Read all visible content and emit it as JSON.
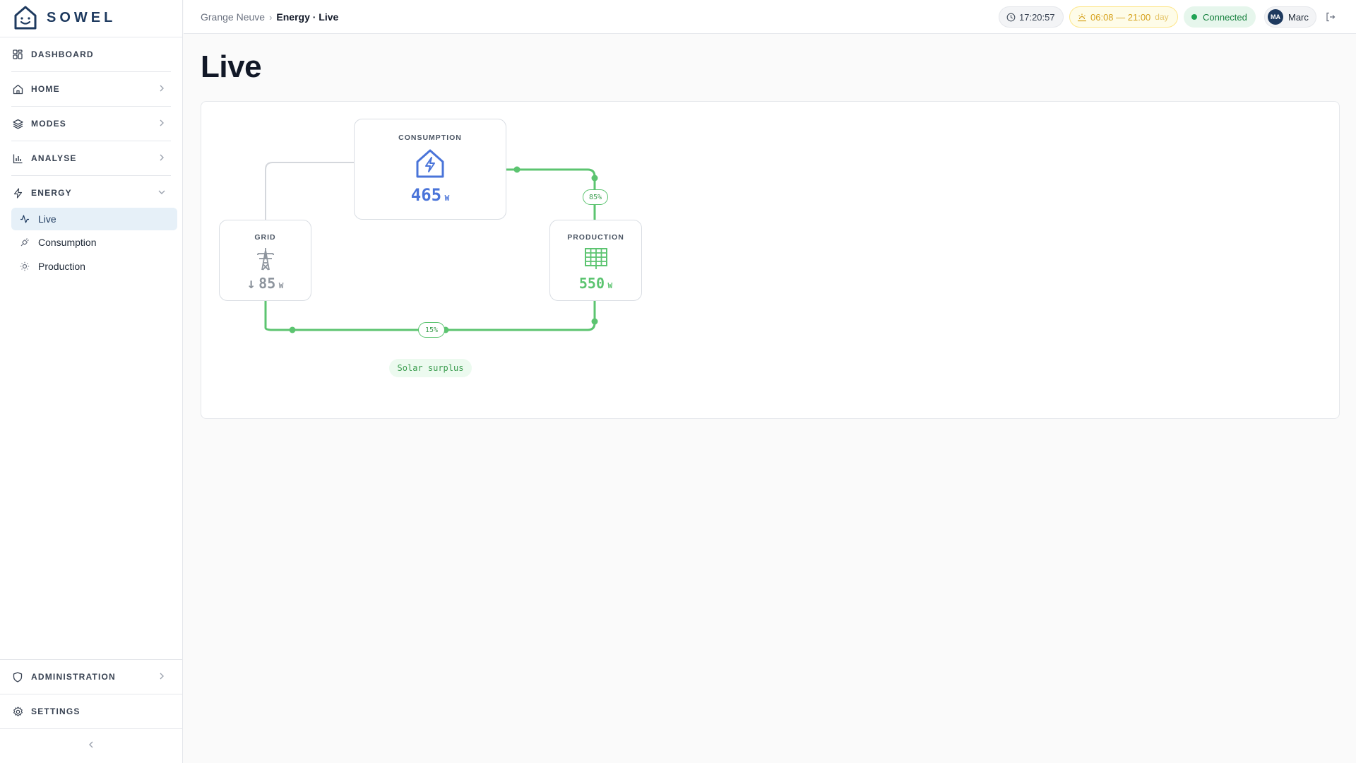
{
  "app": {
    "brand": "SOWEL"
  },
  "sidebar": {
    "items": [
      {
        "label": "DASHBOARD",
        "icon": "grid-icon"
      },
      {
        "label": "HOME",
        "icon": "home-icon"
      },
      {
        "label": "MODES",
        "icon": "layers-icon"
      },
      {
        "label": "ANALYSE",
        "icon": "bar-chart-icon"
      },
      {
        "label": "ENERGY",
        "icon": "bolt-icon",
        "expanded": true
      }
    ],
    "energy_sub": [
      {
        "label": "Live",
        "icon": "activity-icon",
        "active": true
      },
      {
        "label": "Consumption",
        "icon": "plug-icon"
      },
      {
        "label": "Production",
        "icon": "sun-icon"
      }
    ],
    "bottom": [
      {
        "label": "ADMINISTRATION",
        "icon": "shield-icon"
      },
      {
        "label": "SETTINGS",
        "icon": "gear-icon"
      }
    ]
  },
  "header": {
    "breadcrumb_parent": "Grange Neuve",
    "breadcrumb_separator": "›",
    "breadcrumb_current": "Energy · Live",
    "time": "17:20:57",
    "sun_range": "06:08 — 21:00",
    "sun_label": "day",
    "status": "Connected",
    "user_initials": "MA",
    "user_name": "Marc"
  },
  "page": {
    "title": "Live"
  },
  "flow": {
    "consumption": {
      "label": "CONSUMPTION",
      "value": "465",
      "unit": "W",
      "color": "#4a74d9"
    },
    "grid": {
      "label": "GRID",
      "arrow": "↓",
      "value": "85",
      "unit": "W",
      "color": "#8e959e"
    },
    "production": {
      "label": "PRODUCTION",
      "value": "550",
      "unit": "W",
      "color": "#5cc470"
    },
    "production_to_consumption_pct": "85%",
    "production_to_grid_pct": "15%",
    "status_tag": "Solar surplus",
    "line_color": "#5cc470"
  },
  "colors": {
    "brand": "#1e3a5f",
    "active_bg": "#e6f0f8",
    "connected": "#22a356"
  }
}
